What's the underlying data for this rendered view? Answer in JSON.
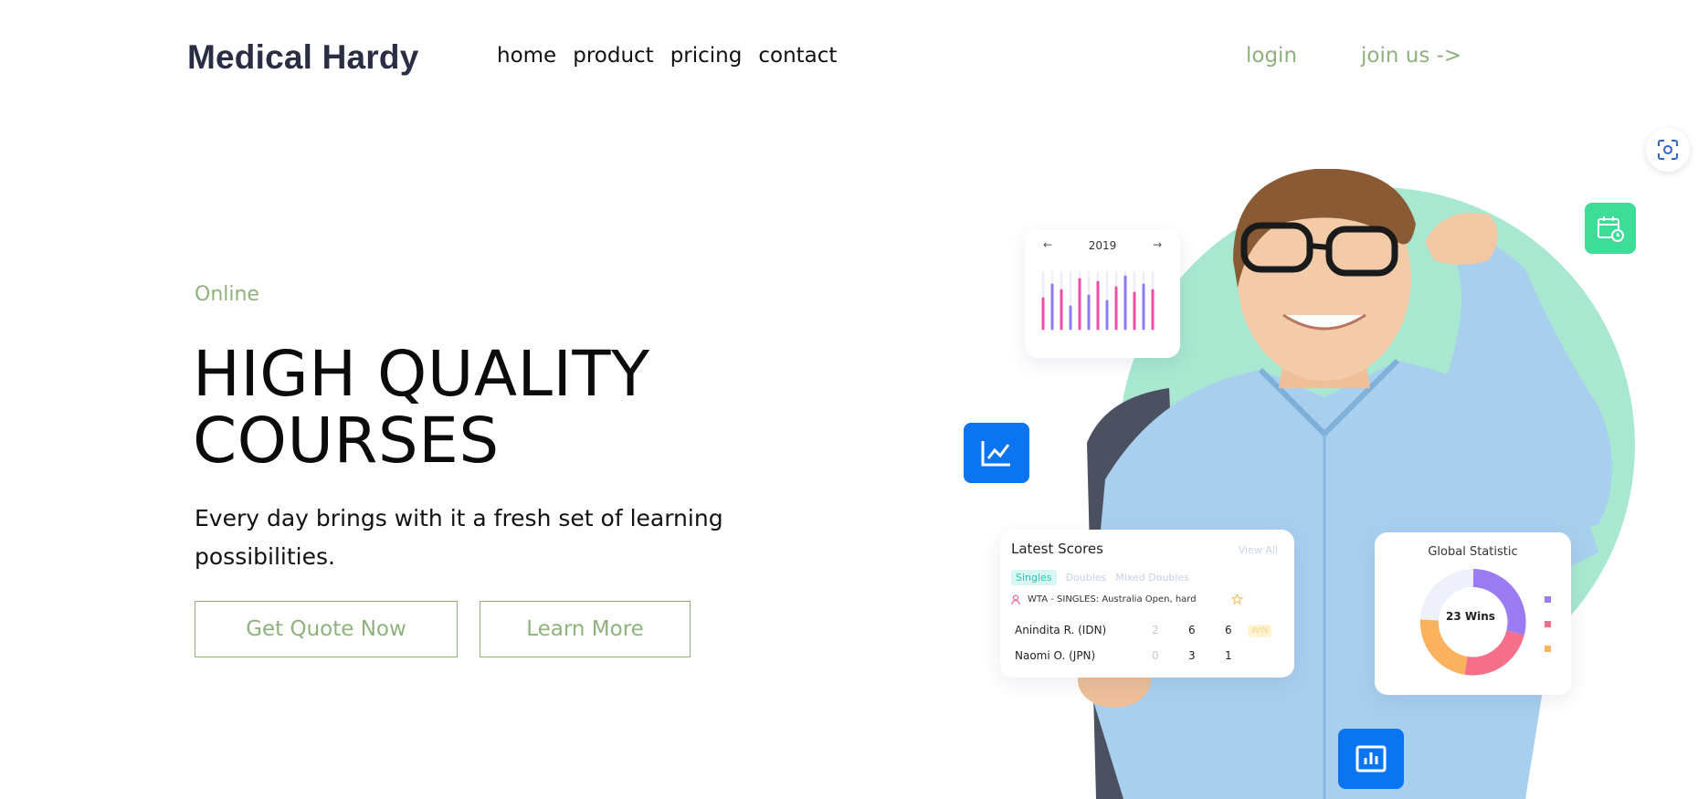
{
  "header": {
    "logo": "Medical Hardy",
    "nav": [
      "home",
      "product",
      "pricing",
      "contact"
    ],
    "login": "login",
    "join": "join us ->"
  },
  "hero": {
    "eyebrow": "Online",
    "headline_line1": "HIGH QUALITY",
    "headline_line2": "COURSES",
    "subtitle": "Every day brings with it a fresh set of learning possibilities.",
    "btn_quote": "Get Quote Now",
    "btn_learn": "Learn More"
  },
  "bar_card": {
    "year": "2019",
    "prev": "←",
    "next": "→"
  },
  "scores_card": {
    "title": "Latest Scores",
    "view_all": "View All",
    "tabs": [
      "Singles",
      "Doubles",
      "Mixed Doubles"
    ],
    "event": "WTA - SINGLES: Australia Open, hard",
    "rows": [
      {
        "name": "Anindita R. (IDN)",
        "s1": "2",
        "s2": "6",
        "s3": "6",
        "tag": "WIN"
      },
      {
        "name": "Naomi O. (JPN)",
        "s1": "0",
        "s2": "3",
        "s3": "1",
        "tag": ""
      }
    ]
  },
  "global_card": {
    "title": "Global Statistic",
    "center": "23 Wins"
  },
  "colors": {
    "accent_green": "#8fb27d",
    "mint": "#a8e8d0",
    "blue": "#0b74f0",
    "logo_navy": "#2a2e45"
  },
  "icons": {
    "scan": "scan-icon",
    "calendar": "calendar-clock-icon",
    "line_chart": "line-chart-icon",
    "bar_chart": "bar-chart-icon"
  }
}
